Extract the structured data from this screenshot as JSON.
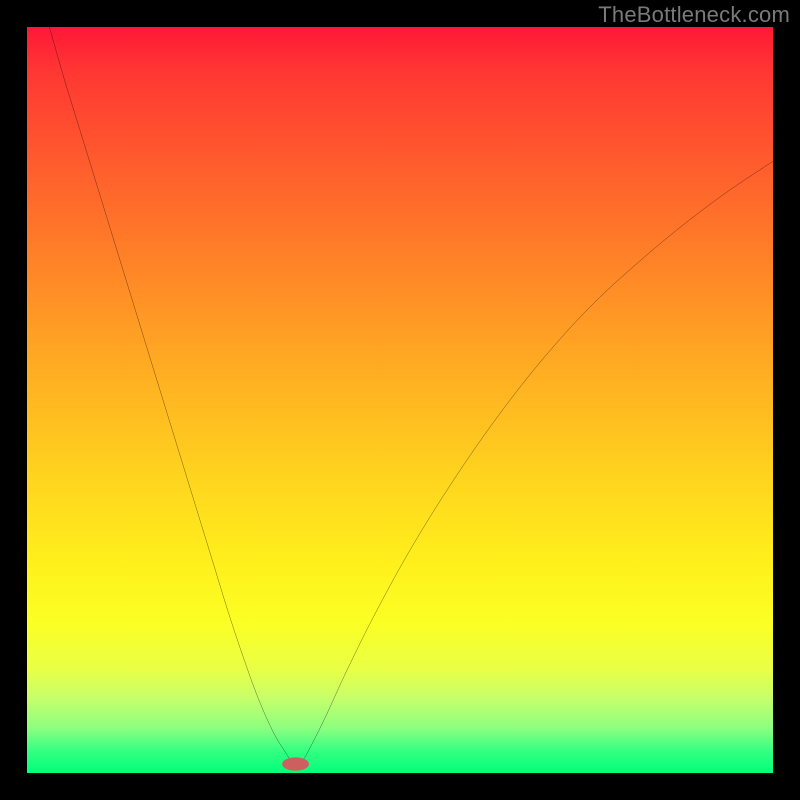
{
  "watermark": {
    "text": "TheBottleneck.com"
  },
  "chart_data": {
    "type": "line",
    "title": "",
    "xlabel": "",
    "ylabel": "",
    "xlim": [
      0,
      100
    ],
    "ylim": [
      0,
      100
    ],
    "grid": false,
    "series": [
      {
        "name": "bottleneck-curve",
        "color": "#000000",
        "x": [
          3,
          5,
          7,
          9,
          11,
          13,
          15,
          17,
          19,
          21,
          23,
          25,
          27,
          29,
          31,
          33,
          34.5,
          35.5,
          36,
          37,
          38,
          40,
          43,
          47,
          52,
          58,
          64,
          70,
          76,
          82,
          88,
          94,
          100
        ],
        "values": [
          100,
          93,
          86.5,
          80,
          73.5,
          67,
          60.5,
          54,
          47.5,
          41,
          34.5,
          28,
          21.5,
          15.5,
          10,
          5.5,
          3,
          1.5,
          1.2,
          1.8,
          3.5,
          7.5,
          14,
          22,
          31,
          40.5,
          49,
          56.5,
          63,
          68.5,
          73.5,
          78,
          82
        ]
      }
    ],
    "marker": {
      "name": "optimal-point",
      "x": 36,
      "y": 1.2,
      "color": "#cc5f5f",
      "rx": 1.8,
      "ry": 0.9
    },
    "gradient_stops": [
      {
        "pos": 0,
        "color": "#ff1836"
      },
      {
        "pos": 6,
        "color": "#ff3733"
      },
      {
        "pos": 18,
        "color": "#ff5b2d"
      },
      {
        "pos": 32,
        "color": "#ff8427"
      },
      {
        "pos": 46,
        "color": "#ffad22"
      },
      {
        "pos": 60,
        "color": "#ffd31e"
      },
      {
        "pos": 72,
        "color": "#fff01c"
      },
      {
        "pos": 80,
        "color": "#fbff24"
      },
      {
        "pos": 86,
        "color": "#e9ff45"
      },
      {
        "pos": 90,
        "color": "#c6ff6a"
      },
      {
        "pos": 94,
        "color": "#8cff80"
      },
      {
        "pos": 97,
        "color": "#35ff82"
      },
      {
        "pos": 100,
        "color": "#00ff7a"
      }
    ]
  }
}
